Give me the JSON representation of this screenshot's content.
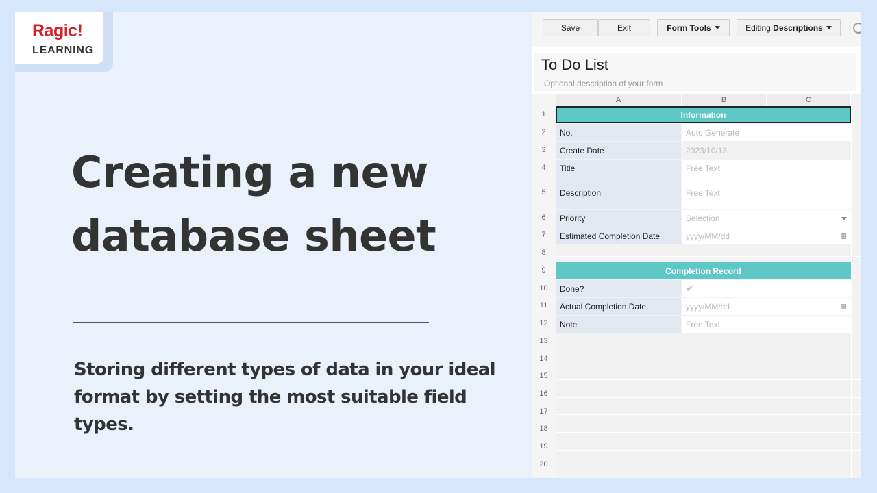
{
  "logo": {
    "brand": "Ragic!",
    "sub": "LEARNING"
  },
  "headline": {
    "line1": "Creating a new",
    "line2": "database sheet"
  },
  "subtitle": {
    "line1": "Storing different types of data in your ideal",
    "line2": "format by setting the most suitable field types."
  },
  "toolbar": {
    "save_label": "Save",
    "exit_label": "Exit",
    "form_tools_label": "Form Tools",
    "editing_prefix": "Editing",
    "editing_value": "Descriptions"
  },
  "form": {
    "title": "To Do List",
    "description_placeholder": "Optional description of your form",
    "columns": [
      "A",
      "B",
      "C"
    ],
    "row_numbers": [
      "1",
      "2",
      "3",
      "4",
      "5",
      "6",
      "7",
      "8",
      "9",
      "10",
      "11",
      "12",
      "13",
      "14",
      "15",
      "16",
      "17",
      "18",
      "19",
      "20"
    ],
    "sections": {
      "information": "Information",
      "completion": "Completion Record"
    },
    "fields": {
      "no": {
        "label": "No.",
        "value": "Auto Generate"
      },
      "create_date": {
        "label": "Create Date",
        "value": "2023/10/13"
      },
      "title": {
        "label": "Title",
        "value": "Free Text"
      },
      "description": {
        "label": "Description",
        "value": "Free Text"
      },
      "priority": {
        "label": "Priority",
        "value": "Selection"
      },
      "est_date": {
        "label": "Estimated Completion Date",
        "value": "yyyy/MM/dd"
      },
      "done": {
        "label": "Done?",
        "value": "✔"
      },
      "actual_date": {
        "label": "Actual Completion Date",
        "value": "yyyy/MM/dd"
      },
      "note": {
        "label": "Note",
        "value": "Free Text"
      }
    }
  },
  "colors": {
    "accent_teal": "#5ec8c6",
    "brand_red": "#d32027",
    "background": "#eaf1fb"
  },
  "icons": [
    "calendar-icon",
    "dropdown-caret-icon",
    "checkmark-icon",
    "search-circle-icon"
  ]
}
